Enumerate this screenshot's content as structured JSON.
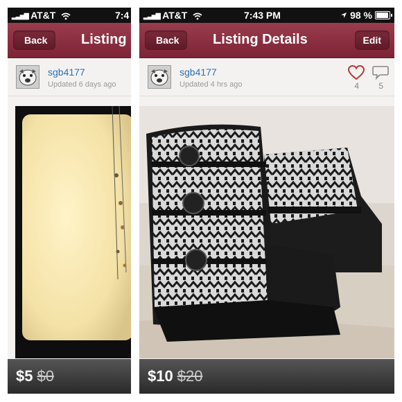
{
  "left_panel": {
    "status": {
      "carrier": "AT&T",
      "time": "7:4"
    },
    "nav": {
      "back_label": "Back",
      "title": "Listing"
    },
    "user": {
      "username": "sgb4177",
      "updated": "Updated 6 days ago"
    },
    "price": {
      "current": "$5",
      "original": "$0"
    }
  },
  "right_panel": {
    "status": {
      "carrier": "AT&T",
      "time": "7:43 PM",
      "battery": "98 %"
    },
    "nav": {
      "back_label": "Back",
      "title": "Listing Details",
      "edit_label": "Edit"
    },
    "user": {
      "username": "sgb4177",
      "updated": "Updated 4 hrs ago",
      "likes": "4",
      "comments": "5"
    },
    "price": {
      "current": "$10",
      "original": "$20"
    }
  },
  "colors": {
    "navbar": "#8a2d3f",
    "link": "#2a6fb5",
    "like": "#b33a3a"
  },
  "icons": [
    "signal-icon",
    "wifi-icon",
    "location-arrow-icon",
    "battery-icon",
    "heart-icon",
    "comment-bubble-icon"
  ]
}
